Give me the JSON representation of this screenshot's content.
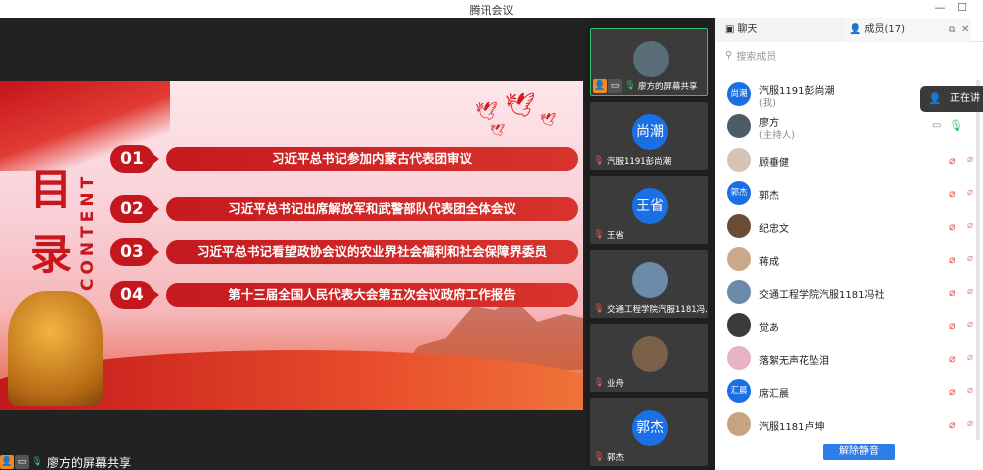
{
  "window": {
    "title": "腾讯会议",
    "min_label": "—",
    "max_label": "☐"
  },
  "slide": {
    "title_char1": "目",
    "title_char2": "录",
    "content_word": "CONTENT",
    "items": [
      {
        "num": "01",
        "text": "习近平总书记参加内蒙古代表团审议"
      },
      {
        "num": "02",
        "text": "习近平总书记出席解放军和武警部队代表团全体会议"
      },
      {
        "num": "03",
        "text": "习近平总书记看望政协会议的农业界社会福利和社会保障界委员"
      },
      {
        "num": "04",
        "text": "第十三届全国人民代表大会第五次会议政府工作报告"
      }
    ]
  },
  "share_label": "廖方的屏幕共享",
  "video_tiles": [
    {
      "name": "廖方的屏幕共享",
      "avatar_text": "",
      "avatar_color": "#5a6e7a"
    },
    {
      "name": "汽服1191彭尚潮",
      "avatar_text": "尚潮",
      "avatar_color": "#1a6fe5"
    },
    {
      "name": "王省",
      "avatar_text": "王省",
      "avatar_color": "#1a6fe5"
    },
    {
      "name": "交通工程学院汽服1181冯...",
      "avatar_text": "",
      "avatar_color": "#6c8ba8"
    },
    {
      "name": "业舟",
      "avatar_text": "",
      "avatar_color": "#7a6148"
    },
    {
      "name": "郭杰",
      "avatar_text": "郭杰",
      "avatar_color": "#1a6fe5"
    }
  ],
  "side": {
    "tab_chat": "聊天",
    "tab_members": "成员(17)",
    "search_placeholder": "搜索成员",
    "members": [
      {
        "name": "汽服1191彭尚潮",
        "role": "(我)",
        "avatar_text": "尚潮",
        "avatar_color": "#1a6fe5"
      },
      {
        "name": "廖方",
        "role": "(主持人)",
        "avatar_text": "",
        "avatar_color": "#4c5c66"
      },
      {
        "name": "顾垂健",
        "role": "",
        "avatar_text": "",
        "avatar_color": "#d7c3b3"
      },
      {
        "name": "郭杰",
        "role": "",
        "avatar_text": "郭杰",
        "avatar_color": "#1a6fe5"
      },
      {
        "name": "纪忠文",
        "role": "",
        "avatar_text": "",
        "avatar_color": "#6b4b34"
      },
      {
        "name": "蒋成",
        "role": "",
        "avatar_text": "",
        "avatar_color": "#c9a98a"
      },
      {
        "name": "交通工程学院汽服1181冯社",
        "role": "",
        "avatar_text": "",
        "avatar_color": "#6c8ba8"
      },
      {
        "name": "觉あ",
        "role": "",
        "avatar_text": "",
        "avatar_color": "#3b3b3b"
      },
      {
        "name": "落絮无声花坠泪",
        "role": "",
        "avatar_text": "",
        "avatar_color": "#e8b3c3"
      },
      {
        "name": "席汇晨",
        "role": "",
        "avatar_text": "汇晨",
        "avatar_color": "#1a6fe5"
      },
      {
        "name": "汽服1181卢坤",
        "role": "",
        "avatar_text": "",
        "avatar_color": "#c7a383"
      }
    ],
    "speaking_label": "正在讲",
    "unmute_button": "解除静音"
  }
}
